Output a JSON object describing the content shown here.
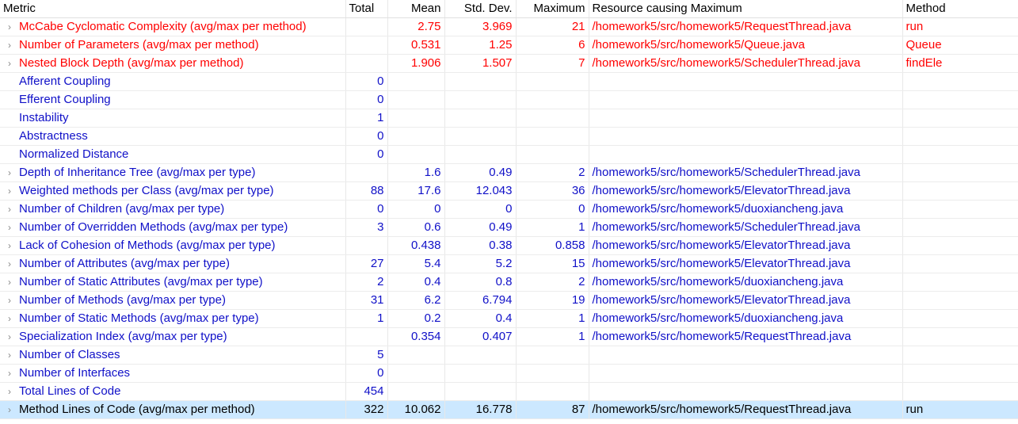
{
  "headers": {
    "metric": "Metric",
    "total": "Total",
    "mean": "Mean",
    "std": "Std. Dev.",
    "maximum": "Maximum",
    "resource": "Resource causing Maximum",
    "method": "Method"
  },
  "rows": [
    {
      "expand": "›",
      "name": "McCabe Cyclomatic Complexity (avg/max per method)",
      "total": "",
      "mean": "2.75",
      "std": "3.969",
      "max": "21",
      "resource": "/homework5/src/homework5/RequestThread.java",
      "method": "run"
    },
    {
      "expand": "›",
      "name": "Number of Parameters (avg/max per method)",
      "total": "",
      "mean": "0.531",
      "std": "1.25",
      "max": "6",
      "resource": "/homework5/src/homework5/Queue.java",
      "method": "Queue"
    },
    {
      "expand": "›",
      "name": "Nested Block Depth (avg/max per method)",
      "total": "",
      "mean": "1.906",
      "std": "1.507",
      "max": "7",
      "resource": "/homework5/src/homework5/SchedulerThread.java",
      "method": "findEle"
    },
    {
      "expand": "",
      "name": "Afferent Coupling",
      "total": "0",
      "mean": "",
      "std": "",
      "max": "",
      "resource": "",
      "method": ""
    },
    {
      "expand": "",
      "name": "Efferent Coupling",
      "total": "0",
      "mean": "",
      "std": "",
      "max": "",
      "resource": "",
      "method": ""
    },
    {
      "expand": "",
      "name": "Instability",
      "total": "1",
      "mean": "",
      "std": "",
      "max": "",
      "resource": "",
      "method": ""
    },
    {
      "expand": "",
      "name": "Abstractness",
      "total": "0",
      "mean": "",
      "std": "",
      "max": "",
      "resource": "",
      "method": ""
    },
    {
      "expand": "",
      "name": "Normalized Distance",
      "total": "0",
      "mean": "",
      "std": "",
      "max": "",
      "resource": "",
      "method": ""
    },
    {
      "expand": "›",
      "name": "Depth of Inheritance Tree (avg/max per type)",
      "total": "",
      "mean": "1.6",
      "std": "0.49",
      "max": "2",
      "resource": "/homework5/src/homework5/SchedulerThread.java",
      "method": ""
    },
    {
      "expand": "›",
      "name": "Weighted methods per Class (avg/max per type)",
      "total": "88",
      "mean": "17.6",
      "std": "12.043",
      "max": "36",
      "resource": "/homework5/src/homework5/ElevatorThread.java",
      "method": ""
    },
    {
      "expand": "›",
      "name": "Number of Children (avg/max per type)",
      "total": "0",
      "mean": "0",
      "std": "0",
      "max": "0",
      "resource": "/homework5/src/homework5/duoxiancheng.java",
      "method": ""
    },
    {
      "expand": "›",
      "name": "Number of Overridden Methods (avg/max per type)",
      "total": "3",
      "mean": "0.6",
      "std": "0.49",
      "max": "1",
      "resource": "/homework5/src/homework5/SchedulerThread.java",
      "method": ""
    },
    {
      "expand": "›",
      "name": "Lack of Cohesion of Methods (avg/max per type)",
      "total": "",
      "mean": "0.438",
      "std": "0.38",
      "max": "0.858",
      "resource": "/homework5/src/homework5/ElevatorThread.java",
      "method": ""
    },
    {
      "expand": "›",
      "name": "Number of Attributes (avg/max per type)",
      "total": "27",
      "mean": "5.4",
      "std": "5.2",
      "max": "15",
      "resource": "/homework5/src/homework5/ElevatorThread.java",
      "method": ""
    },
    {
      "expand": "›",
      "name": "Number of Static Attributes (avg/max per type)",
      "total": "2",
      "mean": "0.4",
      "std": "0.8",
      "max": "2",
      "resource": "/homework5/src/homework5/duoxiancheng.java",
      "method": ""
    },
    {
      "expand": "›",
      "name": "Number of Methods (avg/max per type)",
      "total": "31",
      "mean": "6.2",
      "std": "6.794",
      "max": "19",
      "resource": "/homework5/src/homework5/ElevatorThread.java",
      "method": ""
    },
    {
      "expand": "›",
      "name": "Number of Static Methods (avg/max per type)",
      "total": "1",
      "mean": "0.2",
      "std": "0.4",
      "max": "1",
      "resource": "/homework5/src/homework5/duoxiancheng.java",
      "method": ""
    },
    {
      "expand": "›",
      "name": "Specialization Index (avg/max per type)",
      "total": "",
      "mean": "0.354",
      "std": "0.407",
      "max": "1",
      "resource": "/homework5/src/homework5/RequestThread.java",
      "method": ""
    },
    {
      "expand": "›",
      "name": "Number of Classes",
      "total": "5",
      "mean": "",
      "std": "",
      "max": "",
      "resource": "",
      "method": ""
    },
    {
      "expand": "›",
      "name": "Number of Interfaces",
      "total": "0",
      "mean": "",
      "std": "",
      "max": "",
      "resource": "",
      "method": ""
    },
    {
      "expand": "›",
      "name": "Total Lines of Code",
      "total": "454",
      "mean": "",
      "std": "",
      "max": "",
      "resource": "",
      "method": ""
    },
    {
      "expand": "›",
      "name": "Method Lines of Code (avg/max per method)",
      "total": "322",
      "mean": "10.062",
      "std": "16.778",
      "max": "87",
      "resource": "/homework5/src/homework5/RequestThread.java",
      "method": "run"
    }
  ],
  "colors": {
    "warning_text": "#ff0000",
    "normal_text": "#1010c8",
    "selected_bg": "#cce8ff"
  }
}
